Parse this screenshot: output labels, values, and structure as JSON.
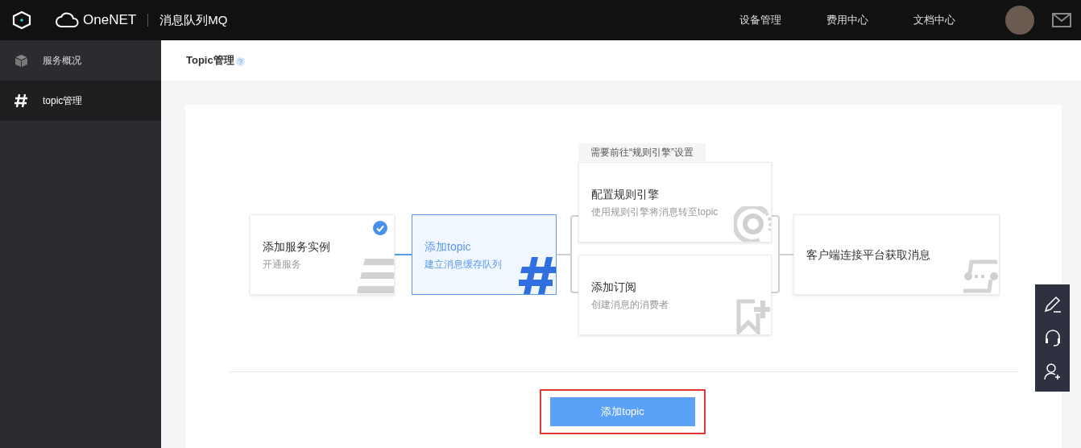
{
  "topbar": {
    "brand": "OneNET",
    "product": "消息队列MQ",
    "nav": [
      "设备管理",
      "费用中心",
      "文档中心"
    ]
  },
  "sidebar": {
    "items": [
      {
        "label": "服务概况",
        "kind": "overview",
        "selected": false
      },
      {
        "label": "topic管理",
        "kind": "topic",
        "selected": true
      }
    ]
  },
  "page": {
    "title": "Topic管理"
  },
  "flow": {
    "note": "需要前往“规则引擎”设置",
    "steps": [
      {
        "kind": "instance",
        "title": "添加服务实例",
        "subtitle": "开通服务",
        "checked": true,
        "selected": false
      },
      {
        "kind": "topic",
        "title": "添加topic",
        "subtitle": "建立消息缓存队列",
        "checked": false,
        "selected": true
      },
      {
        "kind": "rule",
        "title": "配置规则引擎",
        "subtitle": "使用规则引擎将消息转至topic",
        "checked": false,
        "selected": false
      },
      {
        "kind": "subscribe",
        "title": "添加订阅",
        "subtitle": "创建消息的消费者",
        "checked": false,
        "selected": false
      },
      {
        "kind": "client",
        "title": "客户端连接平台获取消息",
        "checked": false,
        "selected": false
      }
    ]
  },
  "action": {
    "label": "添加topic"
  }
}
